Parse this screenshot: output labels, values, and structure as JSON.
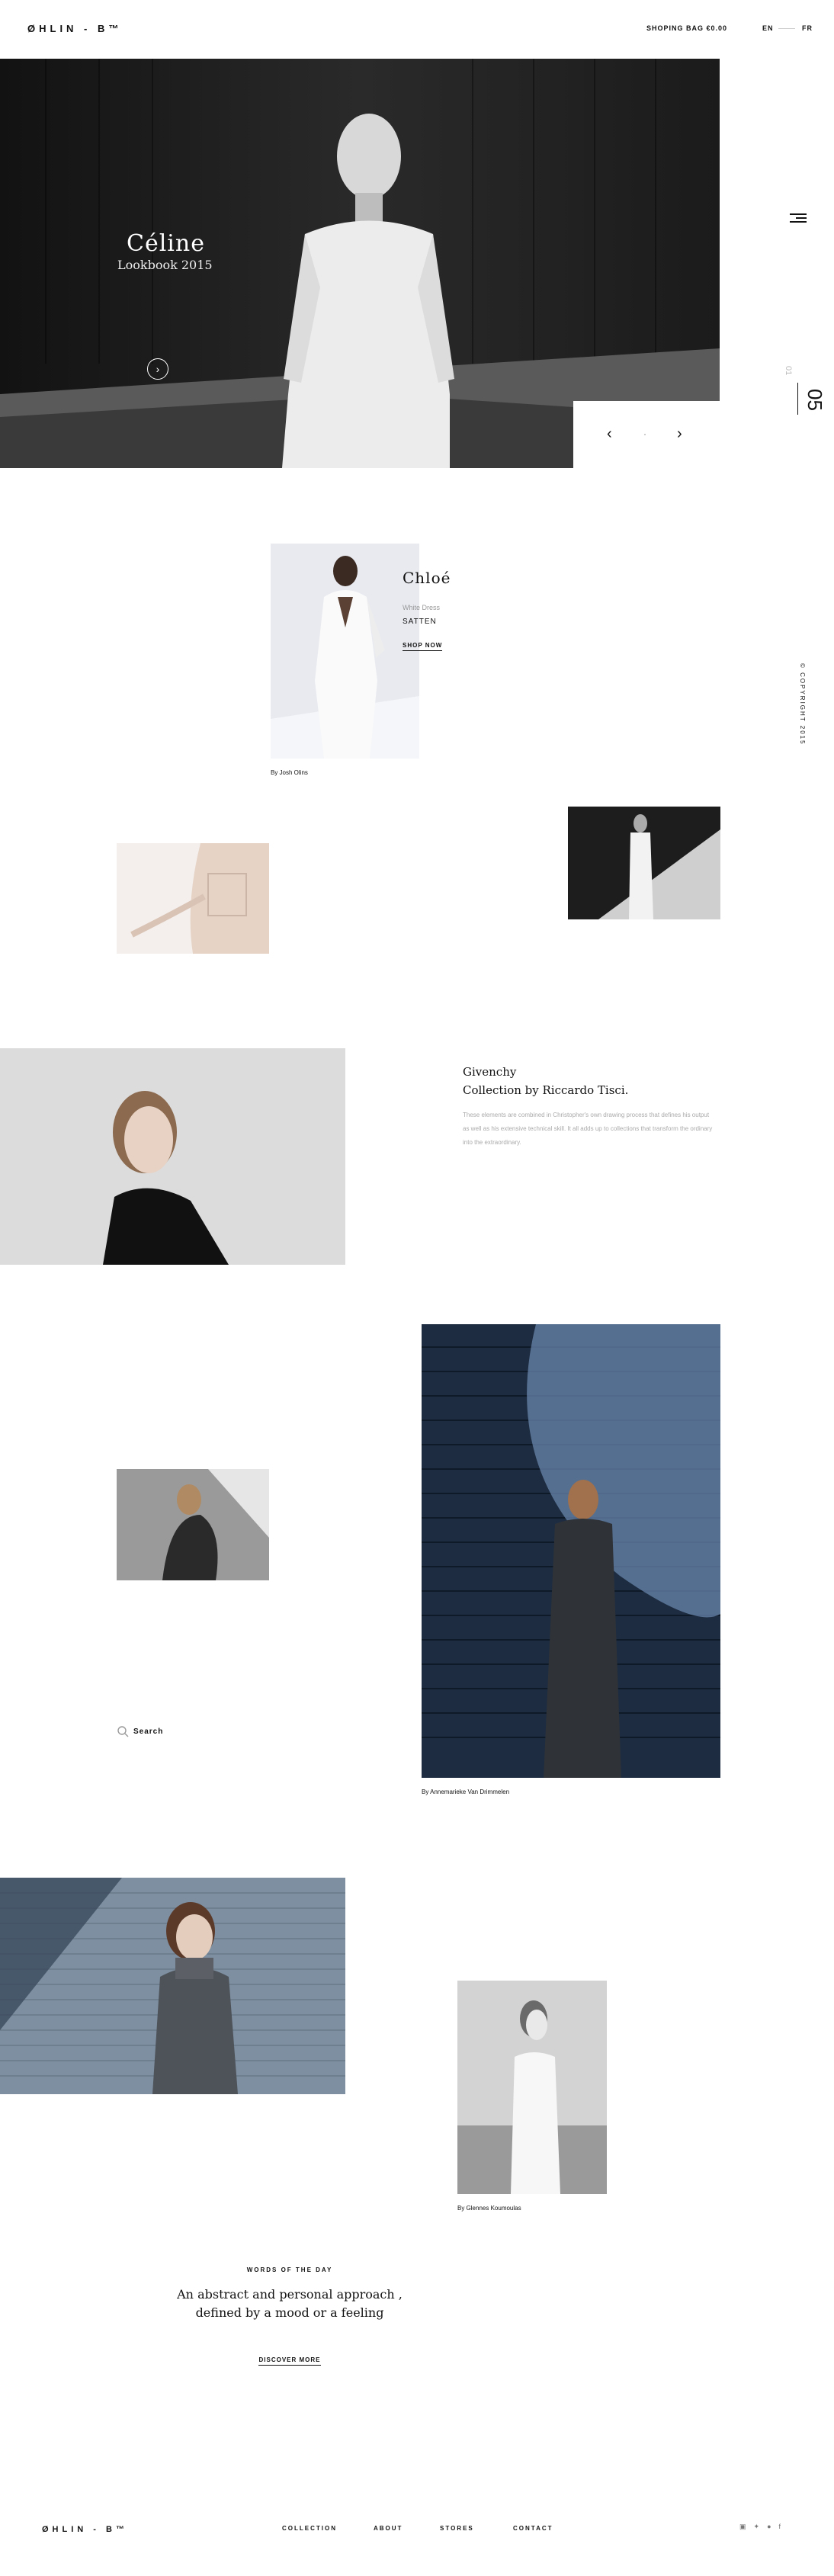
{
  "header": {
    "logo": "ØHLIN - B™",
    "bag": "SHOPING BAG €0.00",
    "lang_en": "EN",
    "lang_fr": "FR"
  },
  "rail": {
    "slide_current": "05",
    "slide_total": "01",
    "copyright": "© COPYRIGHT 2015"
  },
  "hero": {
    "title": "Céline",
    "subtitle": "Lookbook 2015",
    "play_icon": "chevron-right-icon",
    "prev_icon": "chevron-left-icon",
    "next_icon": "chevron-right-icon"
  },
  "chloe": {
    "title": "Chloé",
    "desc": "White Dress",
    "name": "SATTEN",
    "shop": "SHOP NOW",
    "credit": "By Josh Olins"
  },
  "givenchy": {
    "title_line1": "Givenchy",
    "title_line2": "Collection by Riccardo Tisci.",
    "text": "These elements are combined in Christopher's own drawing process that defines his output as well as his extensive technical skill. It all adds up to collections that transform the ordinary into the extraordinary."
  },
  "blue": {
    "credit": "By Annemarieke Van Drimmelen"
  },
  "search": {
    "label": "Search",
    "icon": "search-icon"
  },
  "white": {
    "credit": "By Glennes Koumoulas"
  },
  "words": {
    "kicker": "WORDS OF THE DAY",
    "quote": "An abstract and personal approach , defined by a mood or a feeling",
    "link": "DISCOVER MORE"
  },
  "footer": {
    "logo": "ØHLIN - B™",
    "nav": [
      "COLLECTION",
      "ABOUT",
      "STORES",
      "CONTACT"
    ],
    "social_icons": [
      "instagram-icon",
      "twitter-icon",
      "pinterest-icon",
      "facebook-icon"
    ]
  }
}
